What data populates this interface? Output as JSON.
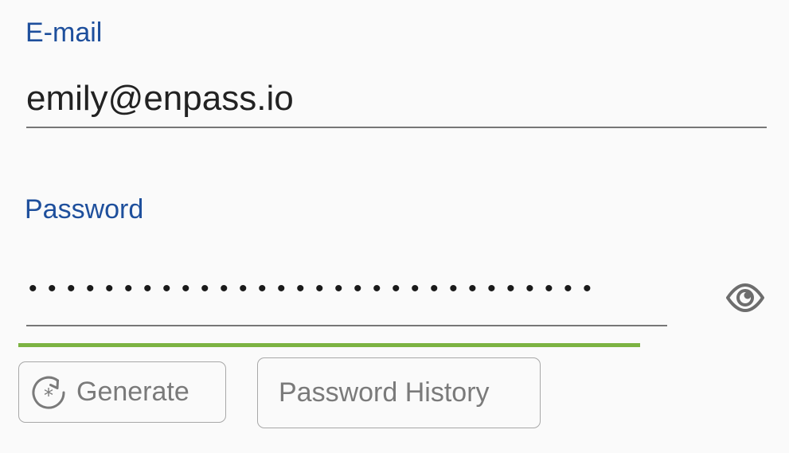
{
  "email": {
    "label": "E-mail",
    "value": "emily@enpass.io"
  },
  "password": {
    "label": "Password",
    "masked_value": "••••••••••••••••••••••••••••••",
    "strength_color": "#7cb342"
  },
  "buttons": {
    "generate_label": "Generate",
    "history_label": "Password History"
  },
  "icons": {
    "visibility": "eye-icon",
    "generate": "refresh-asterisk-icon"
  },
  "colors": {
    "label": "#1e4f9c",
    "underline": "#777777",
    "button_border": "#a8a8a8",
    "button_text": "#7a7a7a"
  }
}
